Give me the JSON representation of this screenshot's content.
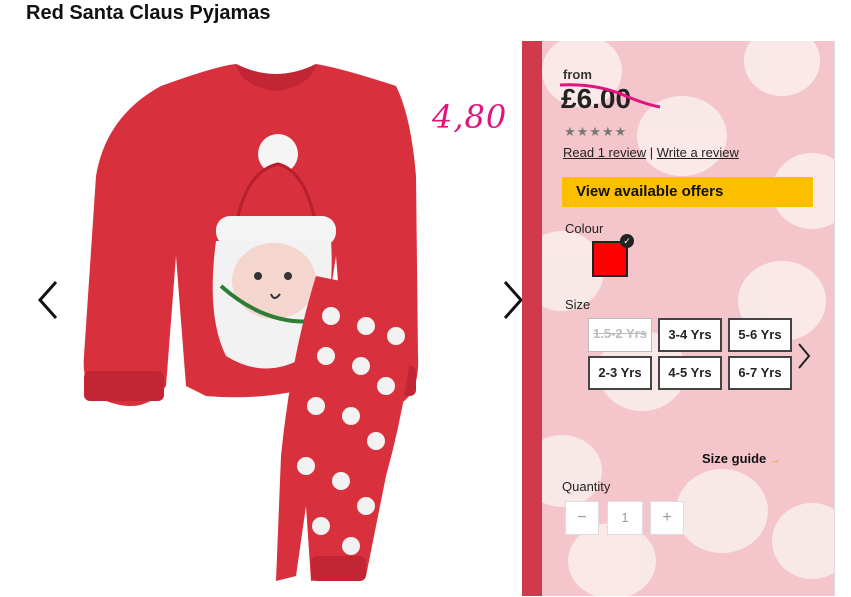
{
  "product": {
    "title": "Red Santa Claus Pyjamas",
    "image_alt": "red santa pyjamas"
  },
  "annotation": {
    "handwritten_price": "4,80",
    "color": "#e0147c"
  },
  "pricing": {
    "from_label": "from",
    "price": "£6.00",
    "rating_stars": "★★★★★"
  },
  "reviews": {
    "read_link": "Read 1 review",
    "separator": "|",
    "write_link": "Write a review"
  },
  "offers": {
    "button_label": "View available offers",
    "color": "#fbbf00"
  },
  "colour": {
    "label": "Colour",
    "selected": "#ff0000"
  },
  "size": {
    "label": "Size",
    "options": [
      {
        "label": "1.5-2 Yrs",
        "available": false
      },
      {
        "label": "3-4 Yrs",
        "available": true
      },
      {
        "label": "5-6 Yrs",
        "available": true
      },
      {
        "label": "2-3 Yrs",
        "available": true
      },
      {
        "label": "4-5 Yrs",
        "available": true
      },
      {
        "label": "6-7 Yrs",
        "available": true
      }
    ],
    "guide_label": "Size guide",
    "guide_arrow": "→"
  },
  "quantity": {
    "label": "Quantity",
    "minus": "−",
    "value": "1",
    "plus": "+"
  },
  "icons": {
    "prev": "chevron-left-icon",
    "next": "chevron-right-icon",
    "sizes_next": "chevron-right-icon",
    "check": "check-icon"
  },
  "colors": {
    "panel_bg": "#f4c6cc",
    "pyjama_red": "#d9303d"
  }
}
